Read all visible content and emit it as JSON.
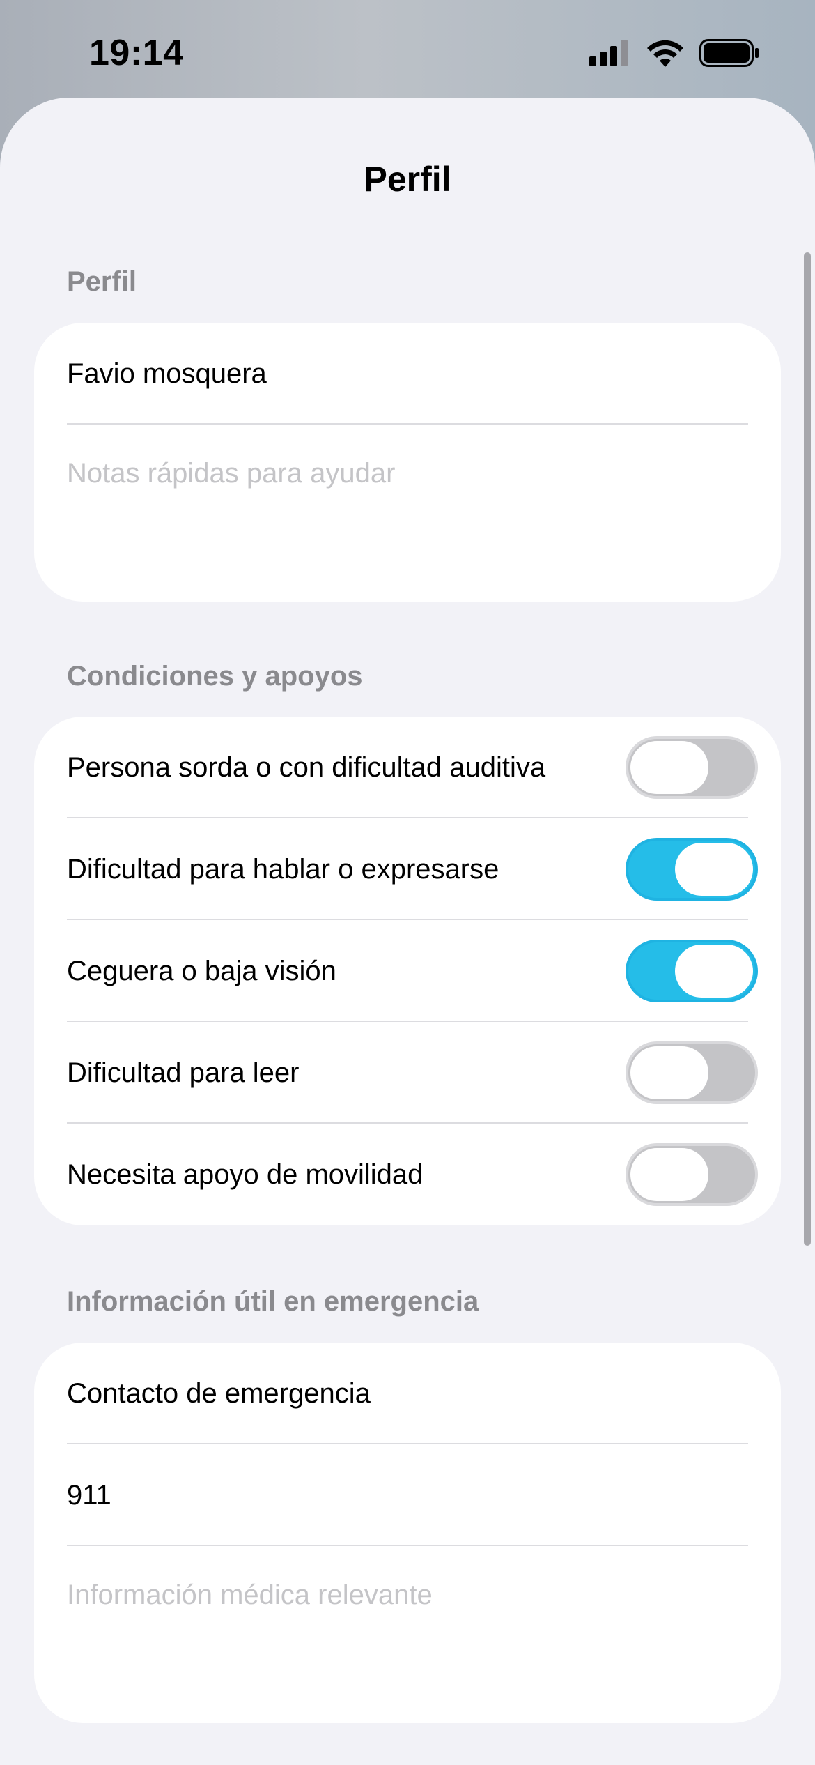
{
  "status_bar": {
    "time": "19:14",
    "icons": [
      "cellular-signal-icon",
      "wifi-icon",
      "battery-icon"
    ]
  },
  "sheet": {
    "title": "Perfil"
  },
  "profile_section": {
    "header": "Perfil",
    "name_value": "Favio mosquera",
    "notes_placeholder": "Notas rápidas para ayudar"
  },
  "conditions_section": {
    "header": "Condiciones y apoyos",
    "items": [
      {
        "label": "Persona sorda o con dificultad auditiva",
        "on": false
      },
      {
        "label": "Dificultad para hablar o expresarse",
        "on": true
      },
      {
        "label": "Ceguera o baja visión",
        "on": true
      },
      {
        "label": "Dificultad para leer",
        "on": false
      },
      {
        "label": "Necesita apoyo de movilidad",
        "on": false
      }
    ]
  },
  "emergency_section": {
    "header": "Información útil en emergencia",
    "contact_value": "Contacto de emergencia",
    "number_value": "911",
    "medical_placeholder": "Información médica relevante"
  },
  "colors": {
    "toggle_on": "#25bde8",
    "toggle_off": "#c4c4c7",
    "background": "#f2f2f7"
  }
}
